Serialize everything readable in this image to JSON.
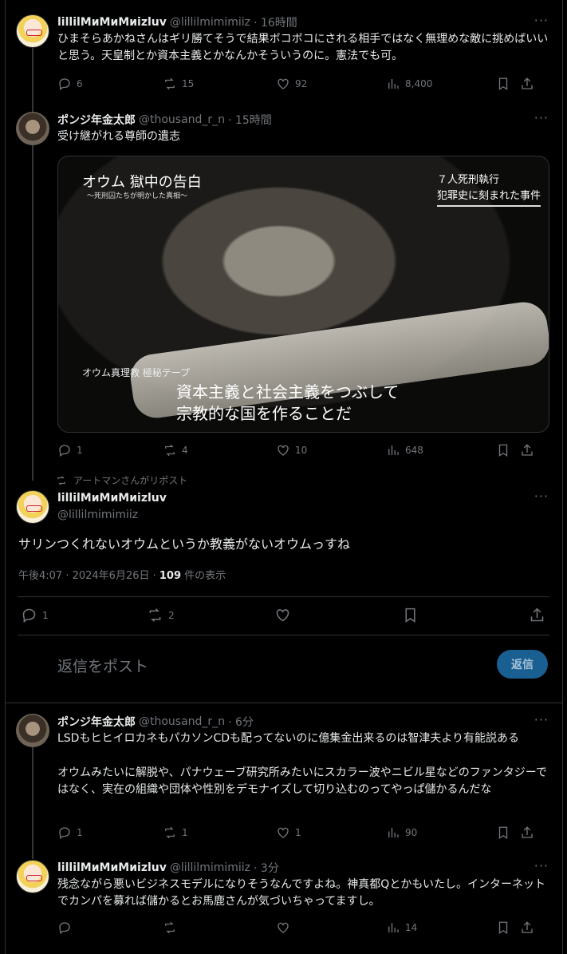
{
  "tweets": [
    {
      "name": "lillilMиMиMиizluv",
      "handle": "@lillilmimimiiz",
      "time": "· 16時間",
      "text": "ひまそらあかねさんはギリ勝てそうで結果ボコボコにされる相手ではなく無理めな敵に挑めばいいと思う。天皇制とか資本主義とかなんかそういうのに。憲法でも可。",
      "replies": "6",
      "reposts": "15",
      "likes": "92",
      "views": "8,400"
    },
    {
      "name": "ポンジ年金太郎",
      "handle": "@thousand_r_n",
      "time": "· 15時間",
      "text": "受け継がれる尊師の遺志",
      "replies": "1",
      "reposts": "4",
      "likes": "10",
      "views": "648"
    }
  ],
  "media": {
    "title": "オウム 獄中の告白",
    "subtitle": "〜死刑囚たちが明かした真相〜",
    "corner_line1": "７人死刑執行",
    "corner_line2": "犯罪史に刻まれた事件",
    "caption_small": "オウム真理教 極秘テープ",
    "caption_line1": "資本主義と社会主義をつぶして",
    "caption_line2": "宗教的な国を作ることだ"
  },
  "repost_label": "アートマンさんがリポスト",
  "focus": {
    "name": "lillilMиMиMиizluv",
    "handle": "@lillilmimimiiz",
    "text": "サリンつくれないオウムというか教義がないオウムっすね",
    "timestamp": "午後4:07 · 2024年6月26日 · ",
    "views_count": "109",
    "views_label": " 件の表示",
    "replies": "1",
    "reposts": "2"
  },
  "reply_composer": {
    "placeholder": "返信をポスト",
    "button_label": "返信"
  },
  "replies": [
    {
      "name": "ポンジ年金太郎",
      "handle": "@thousand_r_n",
      "time": "· 6分",
      "text1": "LSDもヒヒイロカネもパカソンCDも配ってないのに億集金出来るのは智津夫より有能説ある",
      "text2": "オウムみたいに解脱や、パナウェーブ研究所みたいにスカラー波やニビル星などのファンタジーではなく、実在の組織や団体や性別をデモナイズして切り込むのってやっぱ儲かるんだな",
      "replies": "1",
      "reposts": "1",
      "likes": "1",
      "views": "90"
    },
    {
      "name": "lillilMиMиMиizluv",
      "handle": "@lillilmimimiiz",
      "time": "· 3分",
      "text": "残念ながら悪いビジネスモデルになりそうなんですよね。神真都Qとかもいたし。インターネットでカンパを募れば儲かるとお馬鹿さんが気づいちゃってますし。",
      "views": "14"
    }
  ],
  "more_glyph": "···"
}
